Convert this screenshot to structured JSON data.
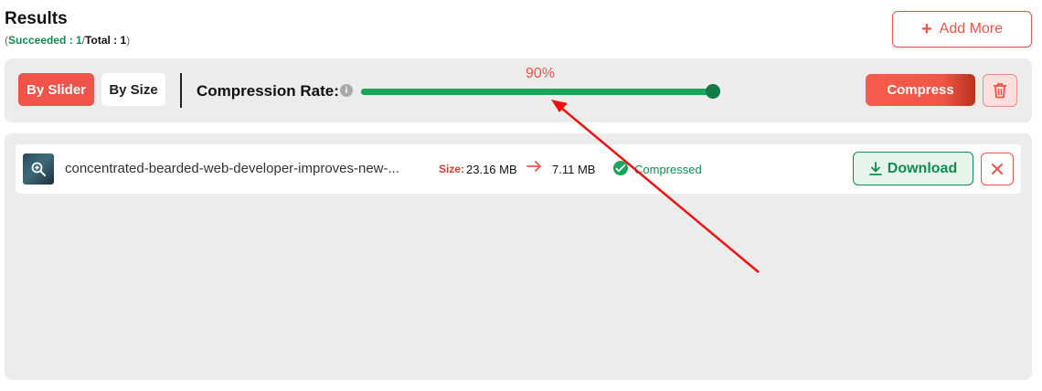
{
  "header": {
    "title": "Results",
    "stats": {
      "open": "(",
      "succeeded": "Succeeded : 1",
      "sep": "/",
      "total": "Total : 1",
      "close": ")"
    },
    "add_more_label": "Add More"
  },
  "toolbar": {
    "mode_slider_label": "By Slider",
    "mode_size_label": "By Size",
    "active_mode": "By Slider",
    "rate_label": "Compression Rate:",
    "info_icon": "i",
    "rate_value": 90,
    "rate_text": "90%",
    "compress_label": "Compress"
  },
  "files": [
    {
      "name": "concentrated-bearded-web-developer-improves-new-...",
      "size_label": "Size:",
      "original_size": "23.16 MB",
      "compressed_size": "7.11 MB",
      "status": "Compressed",
      "download_label": "Download"
    }
  ],
  "colors": {
    "accent_red": "#f0534a",
    "success_green": "#1aa55a",
    "dark_green": "#128a52",
    "annotation_arrow": "#ee1111"
  },
  "icons": [
    "plus-icon",
    "info-icon",
    "trash-icon",
    "zoom-icon",
    "arrow-right-icon",
    "check-circle-icon",
    "download-icon",
    "close-icon"
  ]
}
